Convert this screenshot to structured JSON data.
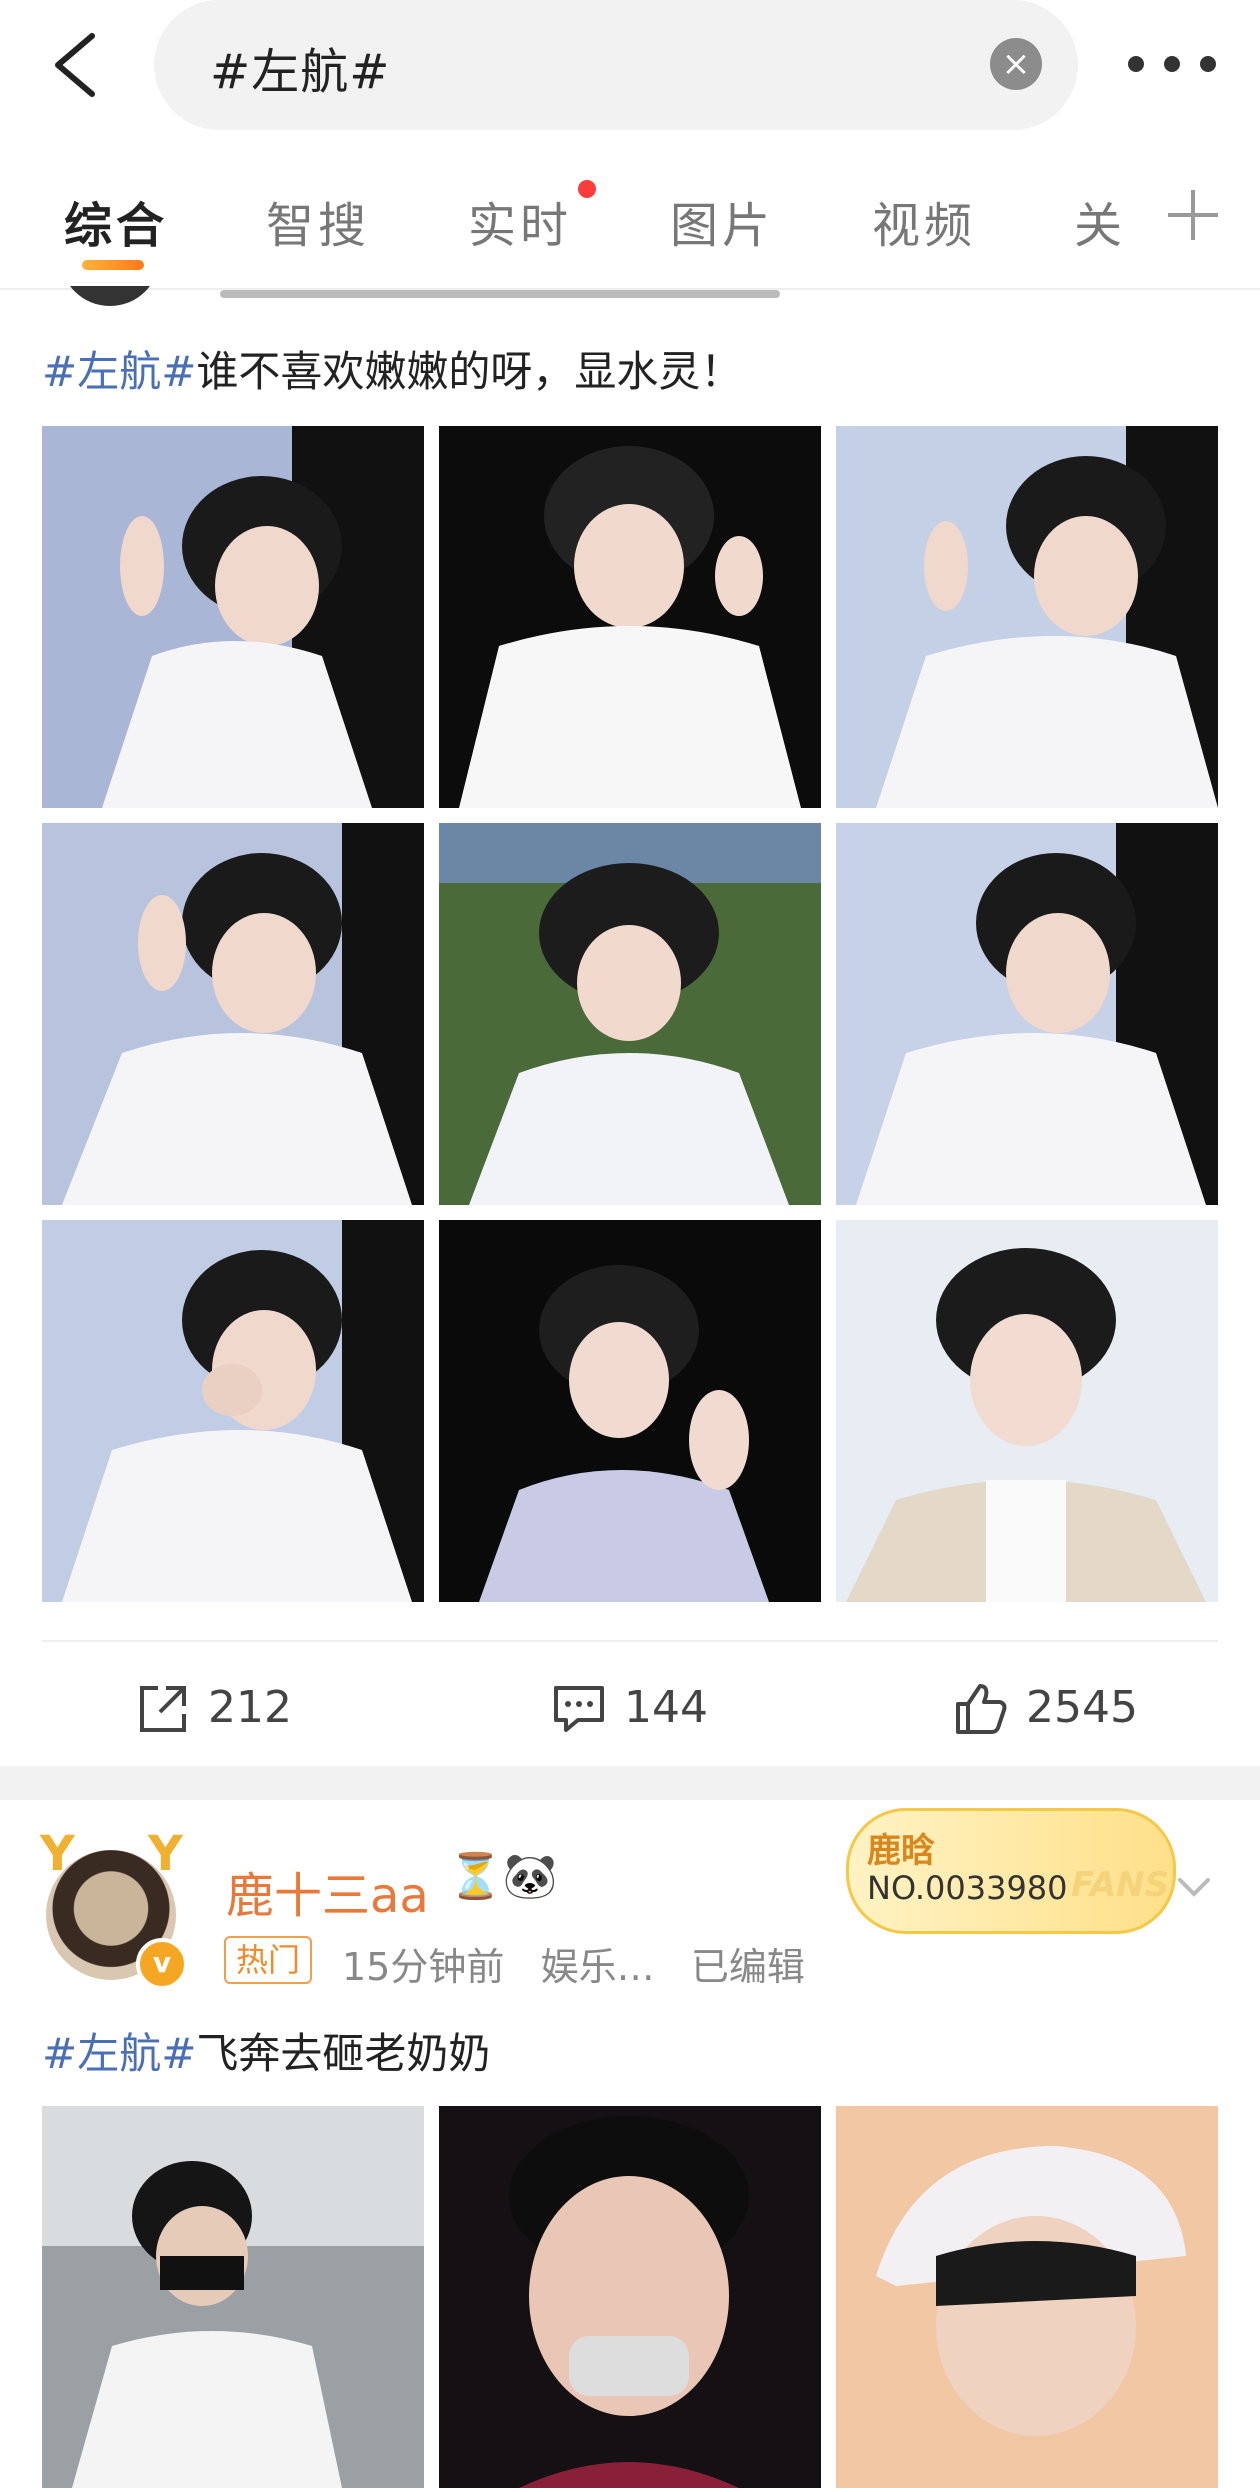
{
  "search": {
    "query": "#左航#"
  },
  "tabs": [
    {
      "label": "综合"
    },
    {
      "label": "智搜"
    },
    {
      "label": "实时"
    },
    {
      "label": "图片"
    },
    {
      "label": "视频"
    },
    {
      "label": "关"
    }
  ],
  "post1": {
    "hashtag": "#左航#",
    "text": "谁不喜欢嫩嫩的呀，显水灵！",
    "stats": {
      "reposts": "212",
      "comments": "144",
      "likes": "2545"
    }
  },
  "post2": {
    "username": "鹿十三aa",
    "name_emojis": "⏳🐼",
    "hot_label": "热门",
    "time": "15分钟前",
    "source": "娱乐…",
    "edited": "已编辑",
    "fans_badge": {
      "name": "鹿晗",
      "number": "NO.0033980",
      "tag": "FANS"
    },
    "hashtag": "#左航#",
    "text": "飞奔去砸老奶奶"
  },
  "colors": {
    "accent_orange": "#ff7a1a",
    "hashtag_blue": "#4a6fb5",
    "username_orange": "#e8793a",
    "notification_red": "#ff3c3c"
  }
}
